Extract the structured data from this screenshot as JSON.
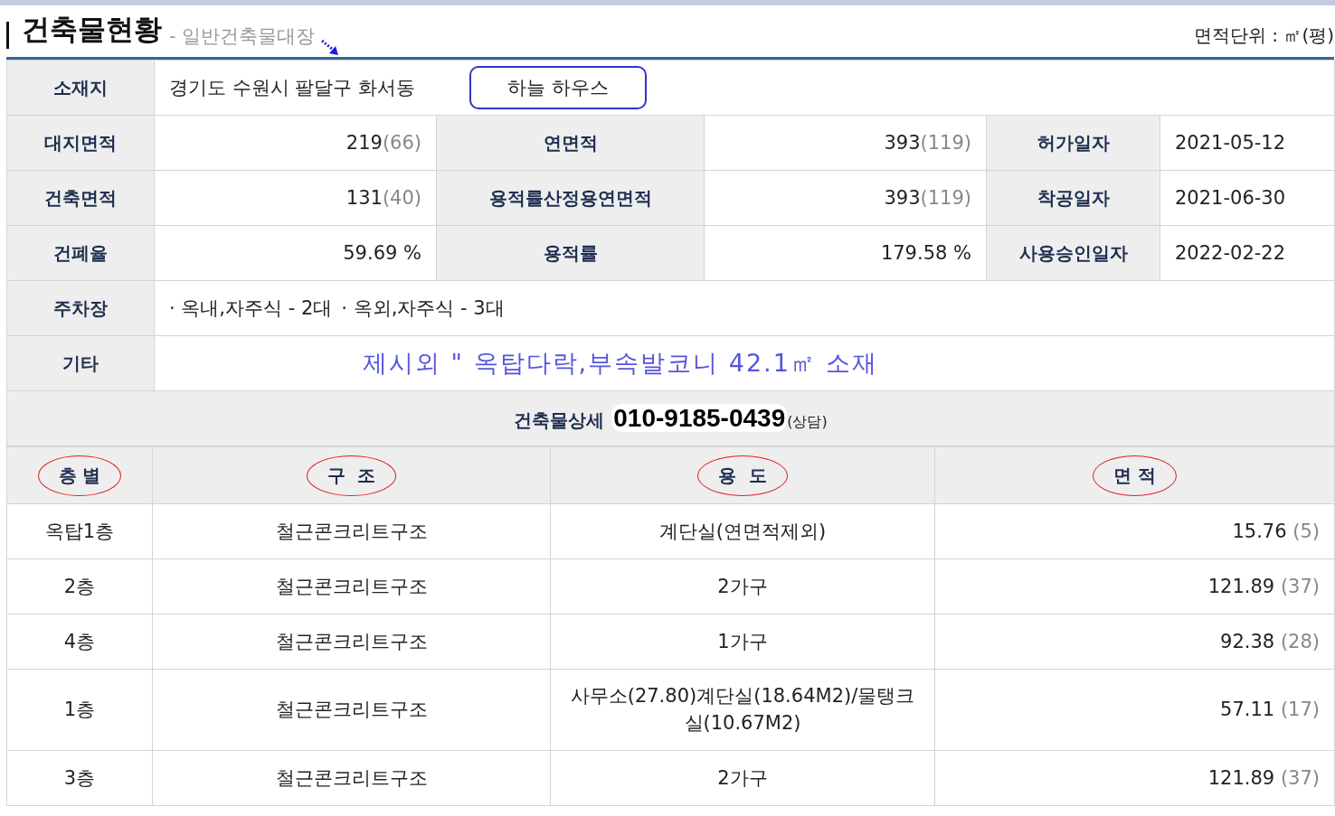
{
  "header": {
    "title": "건축물현황",
    "subtitle": "- 일반건축물대장",
    "unit_note": "면적단위 : ㎡(평)"
  },
  "location": {
    "label": "소재지",
    "address": "경기도 수원시 팔달구 화서동",
    "building_name": "하늘 하우스"
  },
  "info_rows": [
    [
      {
        "label": "대지면적",
        "value": "219",
        "pyeong": "(66)"
      },
      {
        "label": "연면적",
        "value": "393",
        "pyeong": "(119)"
      },
      {
        "label": "허가일자",
        "value": "2021-05-12"
      }
    ],
    [
      {
        "label": "건축면적",
        "value": "131",
        "pyeong": "(40)"
      },
      {
        "label": "용적률산정용연면적",
        "value": "393",
        "pyeong": "(119)"
      },
      {
        "label": "착공일자",
        "value": "2021-06-30"
      }
    ],
    [
      {
        "label": "건폐율",
        "value": "59.69 %"
      },
      {
        "label": "용적률",
        "value": "179.58 %"
      },
      {
        "label": "사용승인일자",
        "value": "2022-02-22"
      }
    ]
  ],
  "parking": {
    "label": "주차장",
    "items": [
      "· 옥내,자주식 - 2대",
      "· 옥외,자주식 - 3대"
    ]
  },
  "other": {
    "label": "기타",
    "text": "제시외 \" 옥탑다락,부속발코니 42.1㎡ 소재"
  },
  "detail": {
    "label": "건축물상세",
    "phone": "010-9185-0439",
    "note": "(상담)"
  },
  "floors": {
    "columns": [
      "층 별",
      "구  조",
      "용  도",
      "면 적"
    ],
    "rows": [
      {
        "floor": "옥탑1층",
        "structure": "철근콘크리트구조",
        "use": "계단실(연면적제외)",
        "area": "15.76",
        "pyeong": "(5)"
      },
      {
        "floor": "2층",
        "structure": "철근콘크리트구조",
        "use": "2가구",
        "area": "121.89",
        "pyeong": "(37)"
      },
      {
        "floor": "4층",
        "structure": "철근콘크리트구조",
        "use": "1가구",
        "area": "92.38",
        "pyeong": "(28)"
      },
      {
        "floor": "1층",
        "structure": "철근콘크리트구조",
        "use": "사무소(27.80)계단실(18.64M2)/물탱크실(10.67M2)",
        "area": "57.11",
        "pyeong": "(17)"
      },
      {
        "floor": "3층",
        "structure": "철근콘크리트구조",
        "use": "2가구",
        "area": "121.89",
        "pyeong": "(37)"
      }
    ]
  }
}
